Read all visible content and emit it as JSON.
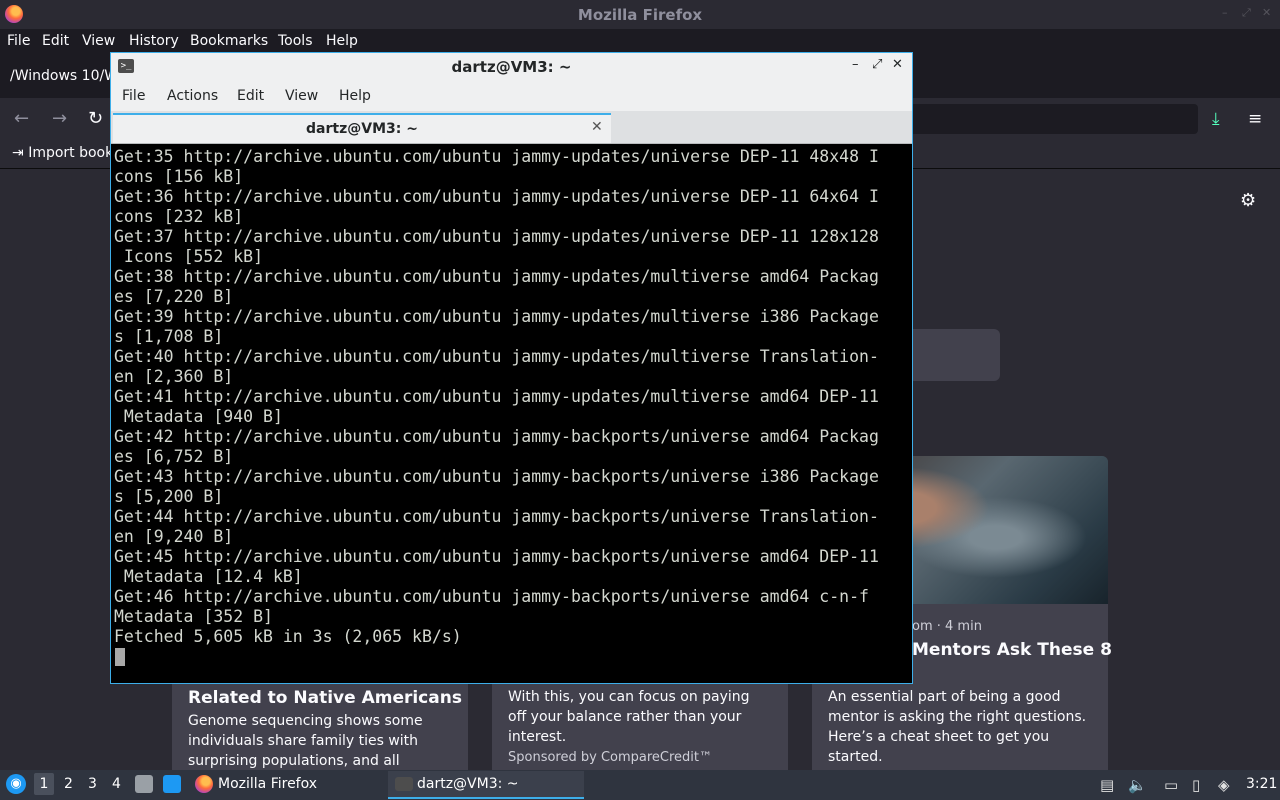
{
  "firefox": {
    "title": "Mozilla Firefox",
    "menu": [
      "File",
      "Edit",
      "View",
      "History",
      "Bookmarks",
      "Tools",
      "Help"
    ],
    "tab_text": "/Windows 10/W",
    "import_bookmarks": "Import book",
    "cards": [
      {
        "title": "Related to Native Americans",
        "body": "Genome sequencing shows some individuals share family ties with surprising populations, and all boast…"
      },
      {
        "body": "With this, you can focus on paying off your balance rather than your interest.",
        "sponsor": "Sponsored by CompareCredit™"
      },
      {
        "meta": "om · 4 min",
        "title": "Mentors Ask These 8",
        "body": "An essential part of being a good mentor is asking the right questions. Here’s a cheat sheet to get you started."
      }
    ]
  },
  "terminal": {
    "title": "dartz@VM3: ~",
    "menu": [
      "File",
      "Actions",
      "Edit",
      "View",
      "Help"
    ],
    "tab_label": "dartz@VM3: ~",
    "lines": [
      "Get:35 http://archive.ubuntu.com/ubuntu jammy-updates/universe DEP-11 48x48 I",
      "cons [156 kB]",
      "Get:36 http://archive.ubuntu.com/ubuntu jammy-updates/universe DEP-11 64x64 I",
      "cons [232 kB]",
      "Get:37 http://archive.ubuntu.com/ubuntu jammy-updates/universe DEP-11 128x128",
      " Icons [552 kB]",
      "Get:38 http://archive.ubuntu.com/ubuntu jammy-updates/multiverse amd64 Packag",
      "es [7,220 B]",
      "Get:39 http://archive.ubuntu.com/ubuntu jammy-updates/multiverse i386 Package",
      "s [1,708 B]",
      "Get:40 http://archive.ubuntu.com/ubuntu jammy-updates/multiverse Translation-",
      "en [2,360 B]",
      "Get:41 http://archive.ubuntu.com/ubuntu jammy-updates/multiverse amd64 DEP-11",
      " Metadata [940 B]",
      "Get:42 http://archive.ubuntu.com/ubuntu jammy-backports/universe amd64 Packag",
      "es [6,752 B]",
      "Get:43 http://archive.ubuntu.com/ubuntu jammy-backports/universe i386 Package",
      "s [5,200 B]",
      "Get:44 http://archive.ubuntu.com/ubuntu jammy-backports/universe Translation-",
      "en [9,240 B]",
      "Get:45 http://archive.ubuntu.com/ubuntu jammy-backports/universe amd64 DEP-11",
      " Metadata [12.4 kB]",
      "Get:46 http://archive.ubuntu.com/ubuntu jammy-backports/universe amd64 c-n-f",
      "Metadata [352 B]",
      "Fetched 5,605 kB in 3s (2,065 kB/s)"
    ]
  },
  "taskbar": {
    "workspaces": [
      "1",
      "2",
      "3",
      "4"
    ],
    "tasks": [
      "Mozilla Firefox",
      "dartz@VM3: ~"
    ],
    "clock": "3:21"
  }
}
